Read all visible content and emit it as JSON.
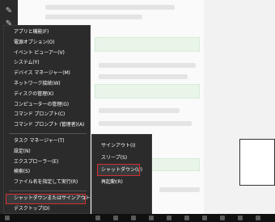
{
  "winx_menu": {
    "items": [
      "アプリと機能(F)",
      "電源オプション(O)",
      "イベント ビューアー(V)",
      "システム(Y)",
      "デバイス マネージャー(M)",
      "ネットワーク接続(W)",
      "ディスクの管理(K)",
      "コンピューターの管理(G)",
      "コマンド プロンプト(C)",
      "コマンド プロンプト (管理者)(A)"
    ],
    "items2": [
      "タスク マネージャー(T)",
      "設定(N)",
      "エクスプローラー(E)",
      "検索(S)",
      "ファイル名を指定して実行(R)"
    ],
    "shutdown_label": "シャットダウンまたはサインアウト(U)",
    "shutdown_chevron": "›",
    "desktop_label": "デスクトップ(D)"
  },
  "submenu": {
    "items": [
      "サインアウト(I)",
      "スリープ(S)",
      "シャットダウン(U)",
      "再起動(R)"
    ]
  },
  "sidebar_icons": [
    "pin-icon",
    "pin-icon"
  ]
}
